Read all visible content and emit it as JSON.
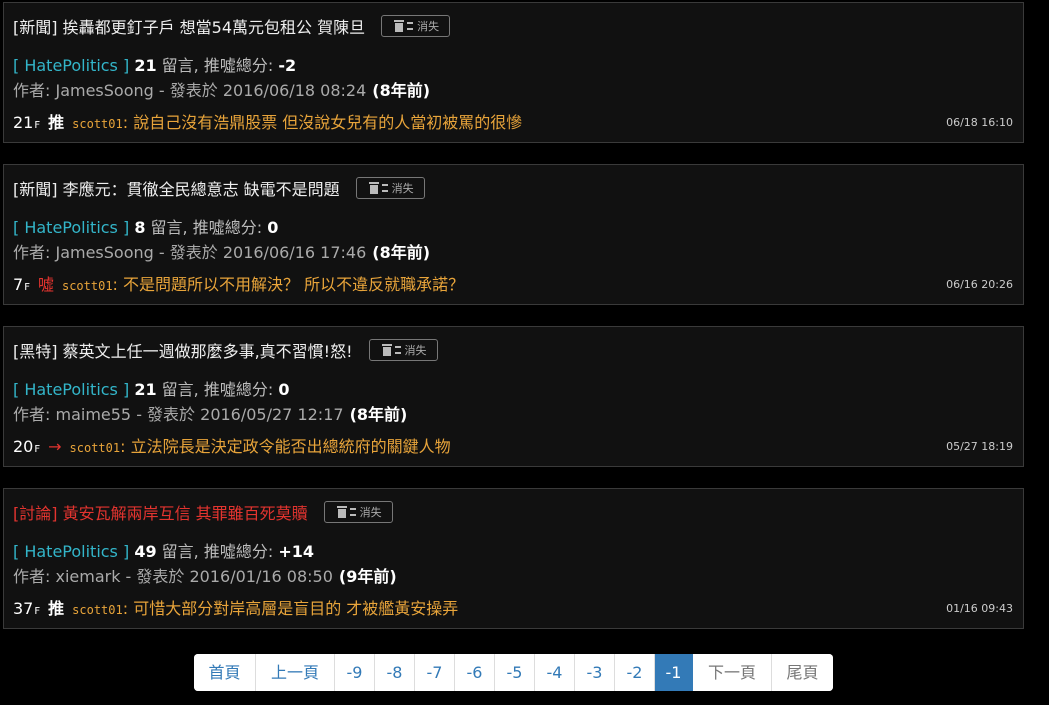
{
  "posts": [
    {
      "title": "[新聞] 挨轟都更釘子戶 想當54萬元包租公 賀陳旦",
      "hide_label": "消失",
      "board": "[ HatePolitics ]",
      "comment_count": "21",
      "comment_label": "留言, 推噓總分:",
      "score": "-2",
      "author_prefix": "作者: JamesSoong - 發表於 2016/06/18 08:24",
      "ago": "(8年前)",
      "floor": "21",
      "floor_suffix": "F",
      "tag": "推",
      "user": "scott01",
      "comment": ": 說自己沒有浩鼎股票 但沒說女兒有的人當初被罵的很慘",
      "time": "06/18 16:10"
    },
    {
      "title": "[新聞] 李應元：貫徹全民總意志 缺電不是問題",
      "hide_label": "消失",
      "board": "[ HatePolitics ]",
      "comment_count": "8",
      "comment_label": "留言, 推噓總分:",
      "score": "0",
      "author_prefix": "作者: JamesSoong - 發表於 2016/06/16 17:46",
      "ago": "(8年前)",
      "floor": "7",
      "floor_suffix": "F",
      "tag": "噓",
      "user": "scott01",
      "comment": ": 不是問題所以不用解決？ 所以不違反就職承諾？",
      "time": "06/16 20:26"
    },
    {
      "title": "[黑特] 蔡英文上任一週做那麼多事,真不習慣!怒!",
      "hide_label": "消失",
      "board": "[ HatePolitics ]",
      "comment_count": "21",
      "comment_label": "留言, 推噓總分:",
      "score": "0",
      "author_prefix": "作者: maime55 - 發表於 2016/05/27 12:17",
      "ago": "(8年前)",
      "floor": "20",
      "floor_suffix": "F",
      "tag": "→",
      "user": "scott01",
      "comment": ": 立法院長是決定政令能否出總統府的關鍵人物",
      "time": "05/27 18:19"
    },
    {
      "title": "[討論] 黃安瓦解兩岸互信 其罪雖百死莫贖",
      "hide_label": "消失",
      "board": "[ HatePolitics ]",
      "comment_count": "49",
      "comment_label": "留言, 推噓總分:",
      "score": "+14",
      "author_prefix": "作者: xiemark - 發表於 2016/01/16 08:50",
      "ago": "(9年前)",
      "floor": "37",
      "floor_suffix": "F",
      "tag": "推",
      "user": "scott01",
      "comment": ": 可惜大部分對岸高層是盲目的 才被艦黃安操弄",
      "time": "01/16 09:43"
    }
  ],
  "pagination": {
    "first": "首頁",
    "prev": "上一頁",
    "pages": [
      "-9",
      "-8",
      "-7",
      "-6",
      "-5",
      "-4",
      "-3",
      "-2",
      "-1"
    ],
    "current": "-1",
    "next": "下一頁",
    "last": "尾頁"
  },
  "colors": {
    "board": "#33b5c9",
    "comment": "#e8a43a",
    "boo": "#e3342f",
    "pager_active": "#337ab7"
  }
}
